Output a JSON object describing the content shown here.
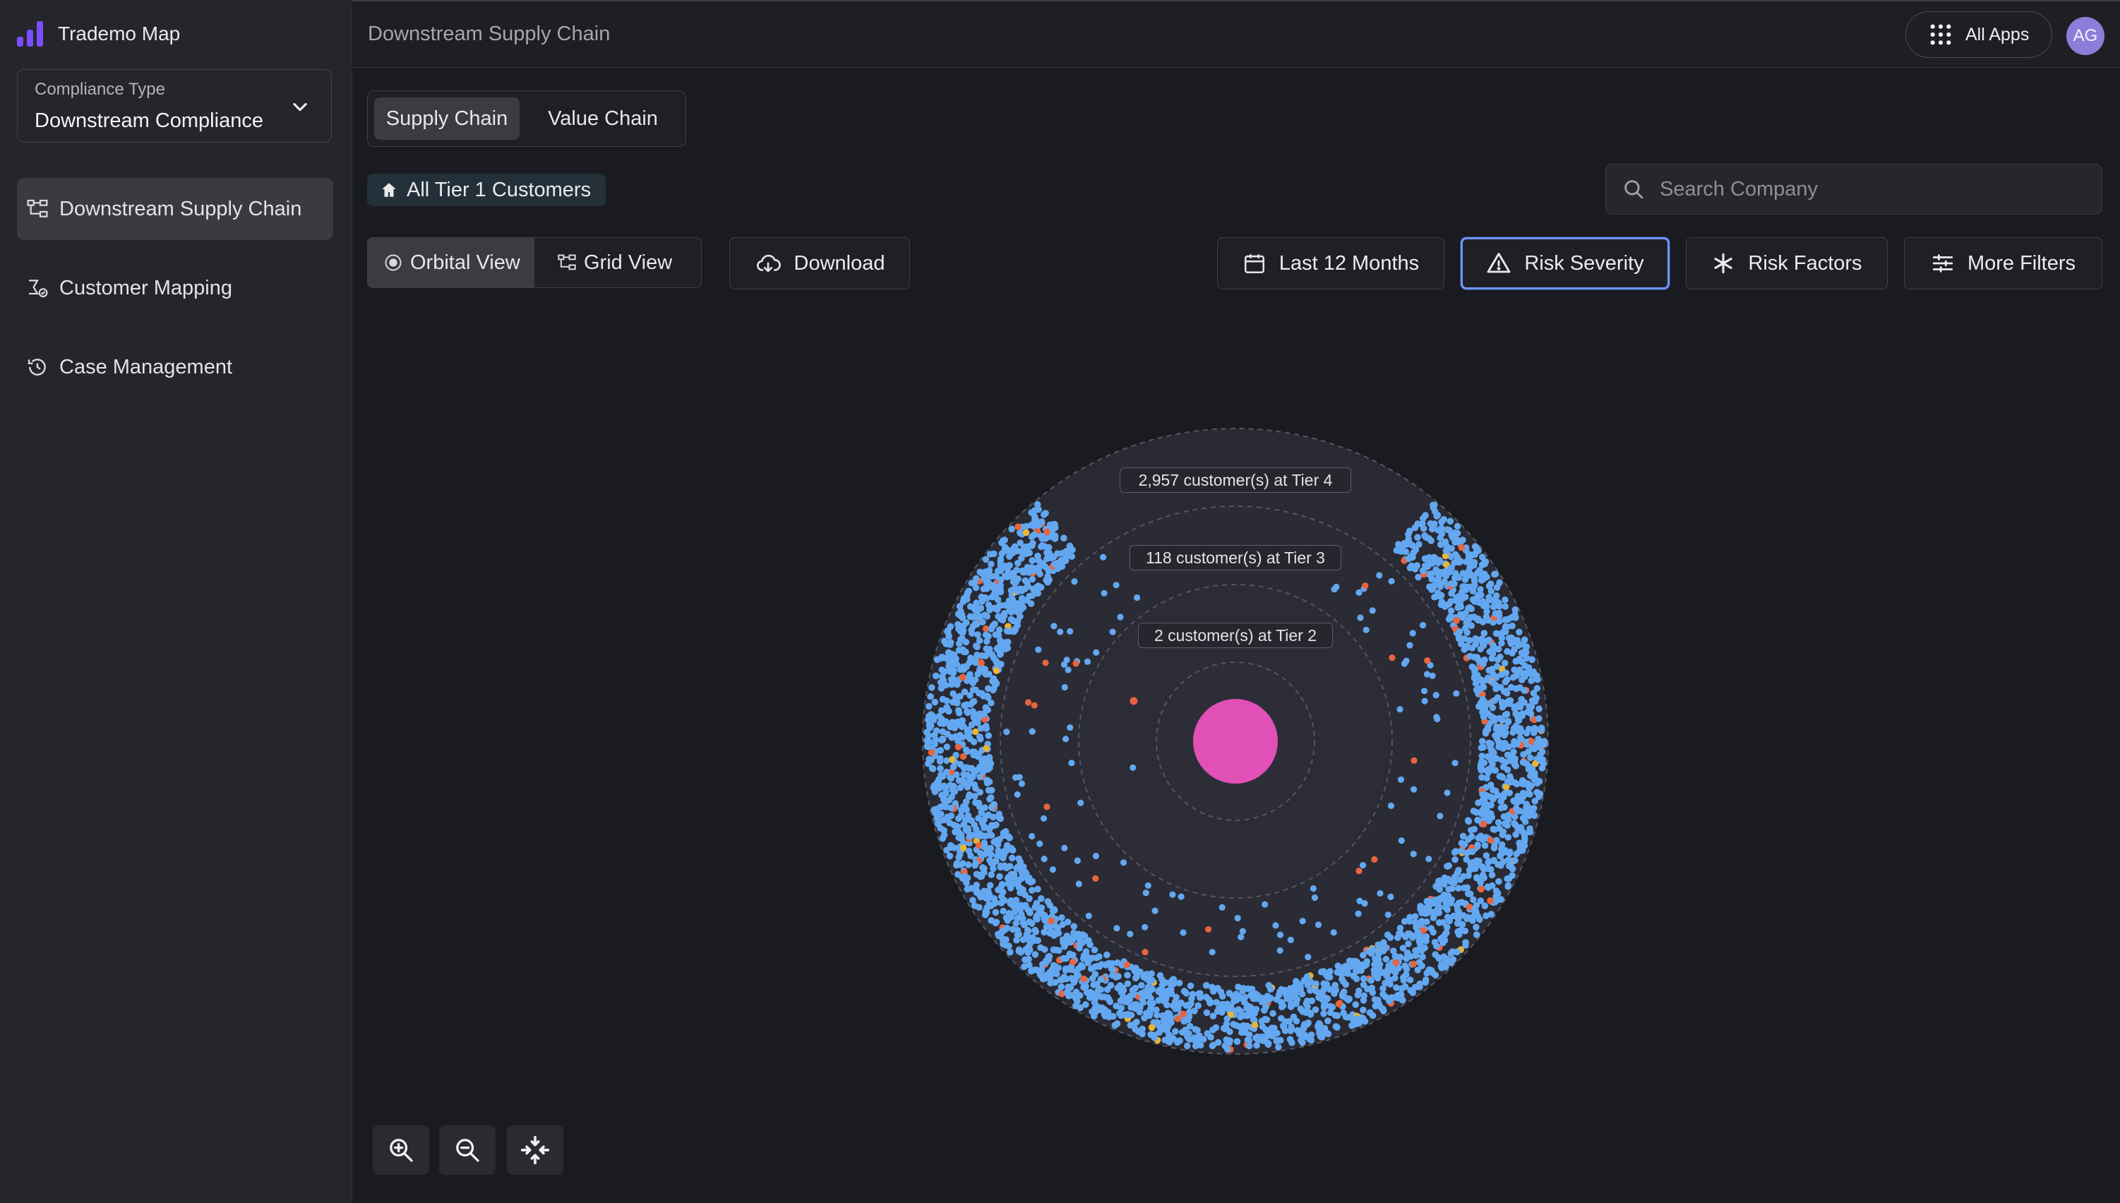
{
  "app": {
    "title": "Trademo Map"
  },
  "sidebar": {
    "compliance": {
      "label": "Compliance Type",
      "value": "Downstream Compliance"
    },
    "items": [
      {
        "label": "Downstream Supply Chain",
        "icon": "hierarchy-icon",
        "active": true
      },
      {
        "label": "Customer Mapping",
        "icon": "mapping-icon",
        "active": false
      },
      {
        "label": "Case Management",
        "icon": "history-icon",
        "active": false
      }
    ]
  },
  "header": {
    "title": "Downstream Supply Chain",
    "apps_label": "All Apps",
    "avatar_initials": "AG"
  },
  "chain_toggle": {
    "supply": "Supply Chain",
    "value": "Value Chain",
    "selected": "Supply Chain"
  },
  "breadcrumb": {
    "label": "All Tier 1 Customers"
  },
  "search": {
    "placeholder": "Search Company"
  },
  "view_toggle": {
    "orbital": "Orbital View",
    "grid": "Grid View",
    "selected": "Orbital View"
  },
  "toolbar": {
    "download": "Download",
    "period": "Last 12 Months",
    "risk_severity": "Risk Severity",
    "risk_factors": "Risk Factors",
    "more_filters": "More Filters"
  },
  "orbit": {
    "tiers": [
      {
        "label": "2,957 customer(s) at Tier 4",
        "count": 2957
      },
      {
        "label": "118 customer(s) at Tier 3",
        "count": 118
      },
      {
        "label": "2 customer(s) at Tier 2",
        "count": 2
      }
    ],
    "colors": {
      "center": "#e150b6",
      "normal": "#63a7f0",
      "high_risk": "#e8643f",
      "medium_risk": "#e6b43a"
    }
  },
  "zoom": {
    "zoom_in": "zoom-in-icon",
    "zoom_out": "zoom-out-icon",
    "fit": "fit-view-icon"
  }
}
